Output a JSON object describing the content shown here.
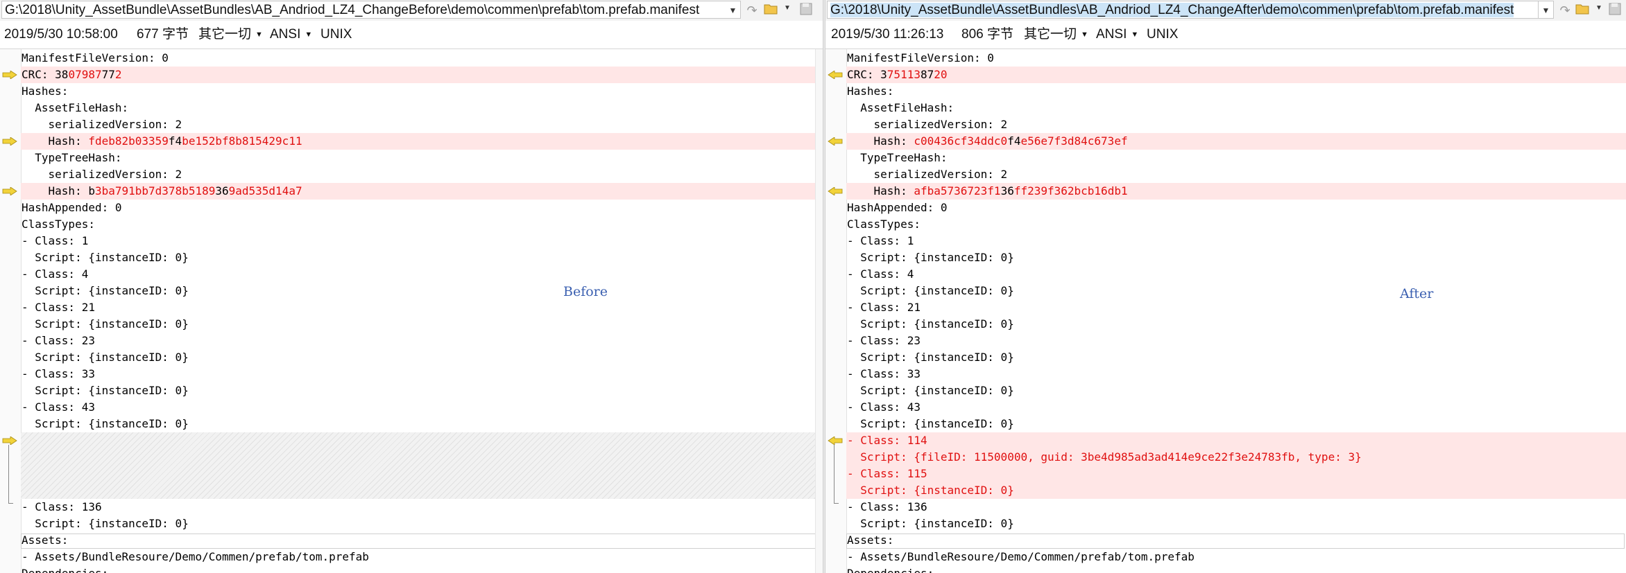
{
  "left": {
    "path": "G:\\2018\\Unity_AssetBundle\\AssetBundles\\AB_Andriod_LZ4_ChangeBefore\\demo\\commen\\prefab\\tom.prefab.manifest",
    "timestamp": "2019/5/30 10:58:00",
    "size": "677 字节",
    "filter": "其它一切",
    "encoding": "ANSI",
    "line_ending": "UNIX",
    "overlay_label": "Before",
    "lines": [
      {
        "segs": [
          {
            "t": "ManifestFileVersion: 0"
          }
        ]
      },
      {
        "diff": true,
        "segs": [
          {
            "t": "CRC: 38"
          },
          {
            "t": "07987",
            "red": true
          },
          {
            "t": "77"
          },
          {
            "t": "2",
            "red": true
          }
        ]
      },
      {
        "segs": [
          {
            "t": "Hashes:"
          }
        ]
      },
      {
        "segs": [
          {
            "t": "  AssetFileHash:"
          }
        ]
      },
      {
        "segs": [
          {
            "t": "    serializedVersion: 2"
          }
        ]
      },
      {
        "diff": true,
        "segs": [
          {
            "t": "    Hash: "
          },
          {
            "t": "fdeb82b03359",
            "red": true
          },
          {
            "t": "f4"
          },
          {
            "t": "be152bf8b815429c11",
            "red": true
          }
        ]
      },
      {
        "segs": [
          {
            "t": "  TypeTreeHash:"
          }
        ]
      },
      {
        "segs": [
          {
            "t": "    serializedVersion: 2"
          }
        ]
      },
      {
        "diff": true,
        "segs": [
          {
            "t": "    Hash: b"
          },
          {
            "t": "3ba791bb7d378b5189",
            "red": true
          },
          {
            "t": "36"
          },
          {
            "t": "9ad535d14a7",
            "red": true
          }
        ]
      },
      {
        "segs": [
          {
            "t": "HashAppended: 0"
          }
        ]
      },
      {
        "segs": [
          {
            "t": "ClassTypes:"
          }
        ]
      },
      {
        "segs": [
          {
            "t": "- Class: 1"
          }
        ]
      },
      {
        "segs": [
          {
            "t": "  Script: {instanceID: 0}"
          }
        ]
      },
      {
        "segs": [
          {
            "t": "- Class: 4"
          }
        ]
      },
      {
        "segs": [
          {
            "t": "  Script: {instanceID: 0}"
          }
        ]
      },
      {
        "segs": [
          {
            "t": "- Class: 21"
          }
        ]
      },
      {
        "segs": [
          {
            "t": "  Script: {instanceID: 0}"
          }
        ]
      },
      {
        "segs": [
          {
            "t": "- Class: 23"
          }
        ]
      },
      {
        "segs": [
          {
            "t": "  Script: {instanceID: 0}"
          }
        ]
      },
      {
        "segs": [
          {
            "t": "- Class: 33"
          }
        ]
      },
      {
        "segs": [
          {
            "t": "  Script: {instanceID: 0}"
          }
        ]
      },
      {
        "segs": [
          {
            "t": "- Class: 43"
          }
        ]
      },
      {
        "segs": [
          {
            "t": "  Script: {instanceID: 0}"
          }
        ]
      },
      {
        "blank": true
      },
      {
        "blank": true
      },
      {
        "blank": true
      },
      {
        "blank": true
      },
      {
        "segs": [
          {
            "t": "- Class: 136"
          }
        ]
      },
      {
        "segs": [
          {
            "t": "  Script: {instanceID: 0}"
          }
        ]
      },
      {
        "segs": [
          {
            "t": "Assets:"
          }
        ]
      },
      {
        "segs": [
          {
            "t": "- Assets/BundleResoure/Demo/Commen/prefab/tom.prefab"
          }
        ]
      },
      {
        "segs": [
          {
            "t": "Dependencies:"
          }
        ]
      }
    ]
  },
  "right": {
    "path": "G:\\2018\\Unity_AssetBundle\\AssetBundles\\AB_Andriod_LZ4_ChangeAfter\\demo\\commen\\prefab\\tom.prefab.manifest",
    "timestamp": "2019/5/30 11:26:13",
    "size": "806 字节",
    "filter": "其它一切",
    "encoding": "ANSI",
    "line_ending": "UNIX",
    "overlay_label": "After",
    "lines": [
      {
        "segs": [
          {
            "t": "ManifestFileVersion: 0"
          }
        ]
      },
      {
        "diff": true,
        "segs": [
          {
            "t": "CRC: 3"
          },
          {
            "t": "75113",
            "red": true
          },
          {
            "t": "87"
          },
          {
            "t": "20",
            "red": true
          }
        ]
      },
      {
        "segs": [
          {
            "t": "Hashes:"
          }
        ]
      },
      {
        "segs": [
          {
            "t": "  AssetFileHash:"
          }
        ]
      },
      {
        "segs": [
          {
            "t": "    serializedVersion: 2"
          }
        ]
      },
      {
        "diff": true,
        "segs": [
          {
            "t": "    Hash: "
          },
          {
            "t": "c00436cf34ddc0",
            "red": true
          },
          {
            "t": "f4"
          },
          {
            "t": "e56e7f3d84c673ef",
            "red": true
          }
        ]
      },
      {
        "segs": [
          {
            "t": "  TypeTreeHash:"
          }
        ]
      },
      {
        "segs": [
          {
            "t": "    serializedVersion: 2"
          }
        ]
      },
      {
        "diff": true,
        "segs": [
          {
            "t": "    Hash: "
          },
          {
            "t": "afba5736723f1",
            "red": true
          },
          {
            "t": "36"
          },
          {
            "t": "ff239f362bcb16db1",
            "red": true
          }
        ]
      },
      {
        "segs": [
          {
            "t": "HashAppended: 0"
          }
        ]
      },
      {
        "segs": [
          {
            "t": "ClassTypes:"
          }
        ]
      },
      {
        "segs": [
          {
            "t": "- Class: 1"
          }
        ]
      },
      {
        "segs": [
          {
            "t": "  Script: {instanceID: 0}"
          }
        ]
      },
      {
        "segs": [
          {
            "t": "- Class: 4"
          }
        ]
      },
      {
        "segs": [
          {
            "t": "  Script: {instanceID: 0}"
          }
        ]
      },
      {
        "segs": [
          {
            "t": "- Class: 21"
          }
        ]
      },
      {
        "segs": [
          {
            "t": "  Script: {instanceID: 0}"
          }
        ]
      },
      {
        "segs": [
          {
            "t": "- Class: 23"
          }
        ]
      },
      {
        "segs": [
          {
            "t": "  Script: {instanceID: 0}"
          }
        ]
      },
      {
        "segs": [
          {
            "t": "- Class: 33"
          }
        ]
      },
      {
        "segs": [
          {
            "t": "  Script: {instanceID: 0}"
          }
        ]
      },
      {
        "segs": [
          {
            "t": "- Class: 43"
          }
        ]
      },
      {
        "segs": [
          {
            "t": "  Script: {instanceID: 0}"
          }
        ]
      },
      {
        "diff": true,
        "add": true,
        "segs": [
          {
            "t": "- Class: 114"
          }
        ]
      },
      {
        "diff": true,
        "add": true,
        "segs": [
          {
            "t": "  Script: {fileID: 11500000, guid: 3be4d985ad3ad414e9ce22f3e24783fb, type: 3}"
          }
        ]
      },
      {
        "diff": true,
        "add": true,
        "segs": [
          {
            "t": "- Class: 115"
          }
        ]
      },
      {
        "diff": true,
        "add": true,
        "segs": [
          {
            "t": "  Script: {instanceID: 0}"
          }
        ]
      },
      {
        "segs": [
          {
            "t": "- Class: 136"
          }
        ]
      },
      {
        "segs": [
          {
            "t": "  Script: {instanceID: 0}"
          }
        ]
      },
      {
        "segs": [
          {
            "t": "Assets:"
          }
        ]
      },
      {
        "segs": [
          {
            "t": "- Assets/BundleResoure/Demo/Commen/prefab/tom.prefab"
          }
        ]
      },
      {
        "segs": [
          {
            "t": "Dependencies:"
          }
        ]
      }
    ]
  },
  "colors": {
    "diff_bg": "#ffe6e6",
    "diff_text": "#e01010",
    "arrow_fill": "#f2d33a",
    "overlay_label": "#3a5fb0"
  },
  "icons": {
    "toolbar": [
      "chevron-down-icon",
      "swap-icon",
      "folder-open-icon",
      "save-icon"
    ],
    "gutter": "diff-arrow-icon"
  }
}
